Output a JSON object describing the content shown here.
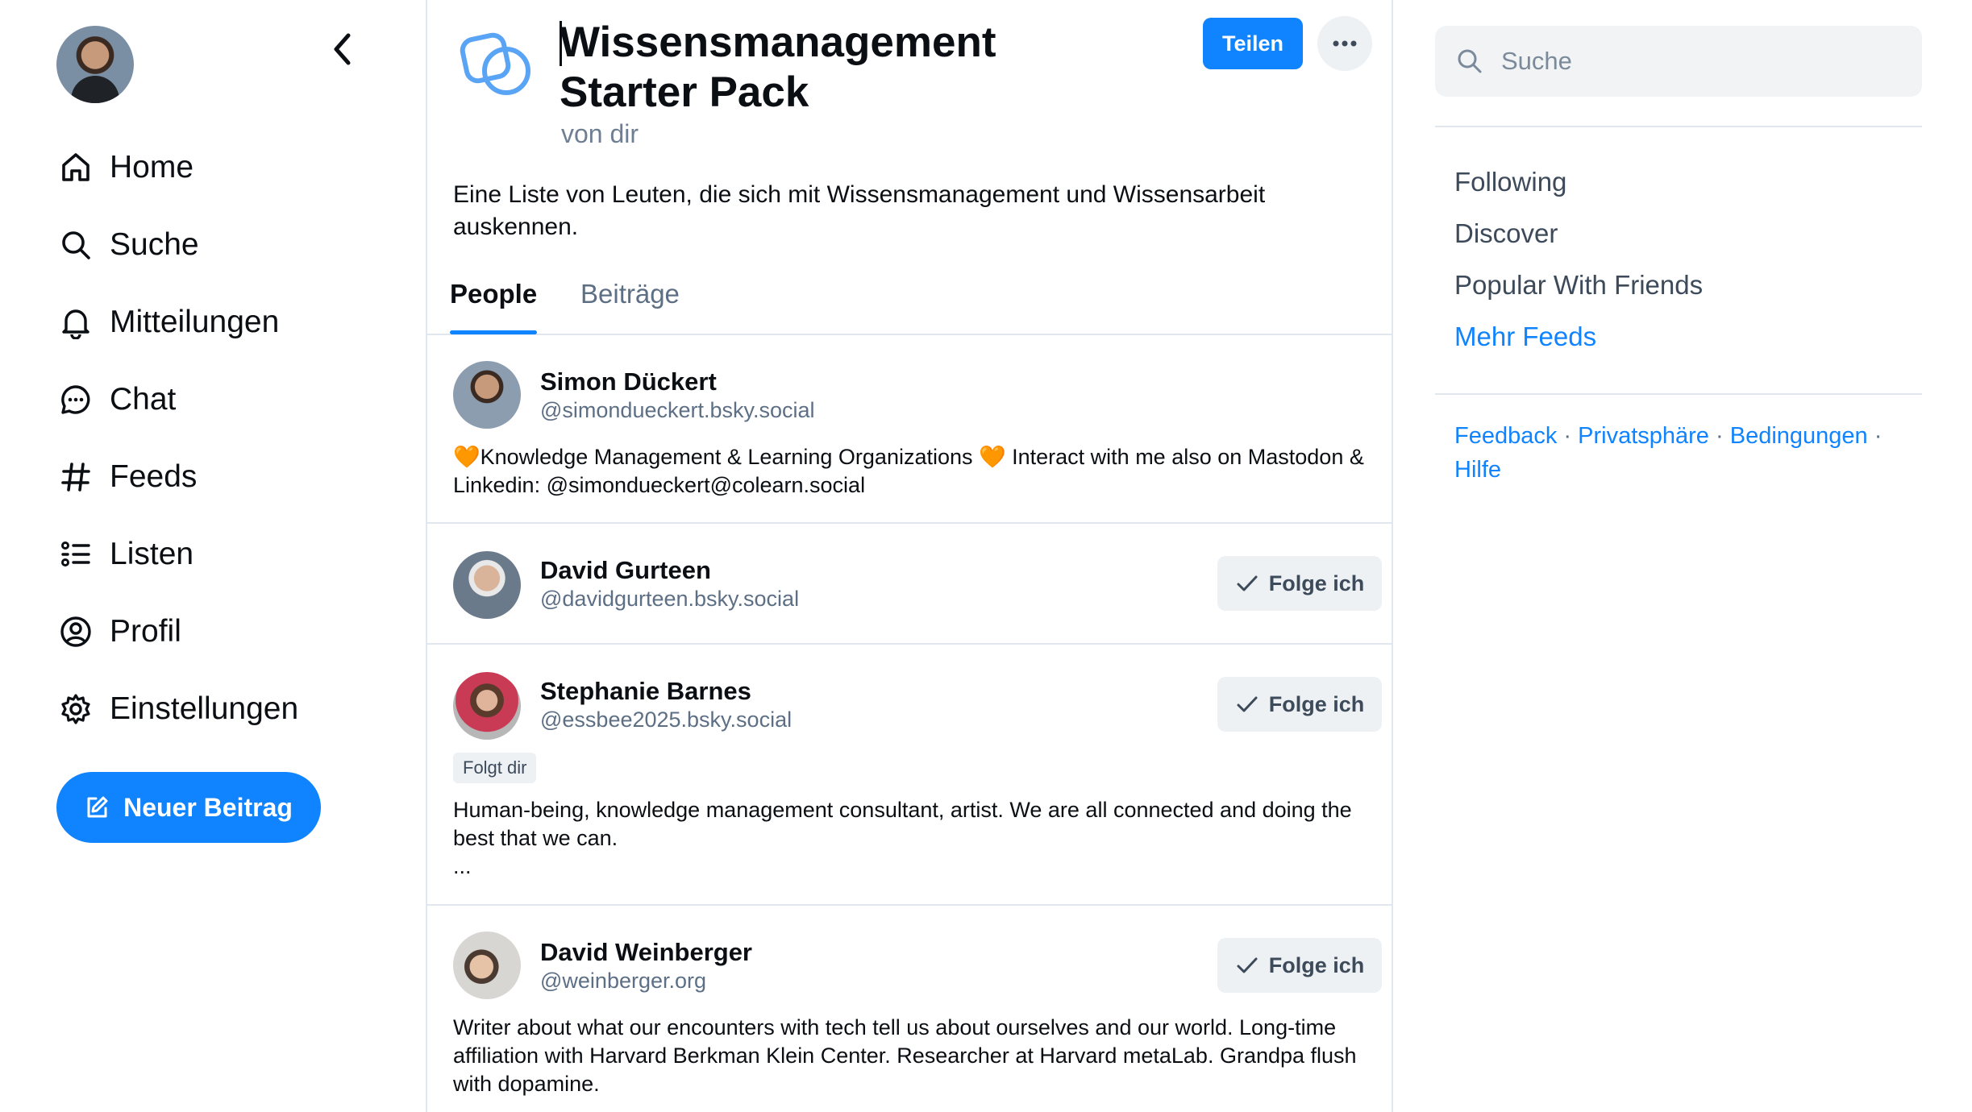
{
  "sidebar": {
    "items": [
      {
        "label": "Home",
        "icon": "home-icon"
      },
      {
        "label": "Suche",
        "icon": "search-icon"
      },
      {
        "label": "Mitteilungen",
        "icon": "bell-icon"
      },
      {
        "label": "Chat",
        "icon": "chat-bubble-icon"
      },
      {
        "label": "Feeds",
        "icon": "hash-icon"
      },
      {
        "label": "Listen",
        "icon": "list-icon"
      },
      {
        "label": "Profil",
        "icon": "user-circle-icon"
      },
      {
        "label": "Einstellungen",
        "icon": "gear-icon"
      }
    ],
    "new_post_label": "Neuer Beitrag"
  },
  "pack": {
    "title": "Wissensmanagement Starter Pack",
    "byline": "von dir",
    "share_label": "Teilen",
    "description": "Eine Liste von Leuten, die sich mit Wissensmanagement und Wissensarbeit auskennen.",
    "tabs": [
      {
        "label": "People",
        "active": true
      },
      {
        "label": "Beiträge",
        "active": false
      }
    ]
  },
  "people": [
    {
      "name": "Simon Dückert",
      "handle": "@simondueckert.bsky.social",
      "bio": "🧡Knowledge Management & Learning Organizations 🧡 Interact with me also on Mastodon & Linkedin: @simondueckert@colearn.social"
    },
    {
      "name": "David Gurteen",
      "handle": "@davidgurteen.bsky.social",
      "follow_label": "Folge ich"
    },
    {
      "name": "Stephanie Barnes",
      "handle": "@essbee2025.bsky.social",
      "follow_label": "Folge ich",
      "badge": "Folgt dir",
      "bio": "Human-being, knowledge management consultant, artist. We are all connected and doing the best that we can.\n..."
    },
    {
      "name": "David Weinberger",
      "handle": "@weinberger.org",
      "follow_label": "Folge ich",
      "bio": "Writer about what our encounters with tech tell us about ourselves and our world. Long-time affiliation with Harvard Berkman Klein Center. Researcher at Harvard metaLab. Grandpa flush with dopamine."
    }
  ],
  "right": {
    "search_placeholder": "Suche",
    "feeds": [
      "Following",
      "Discover",
      "Popular With Friends"
    ],
    "more_feeds": "Mehr Feeds",
    "footer": [
      "Feedback",
      "Privatsphäre",
      "Bedingungen",
      "Hilfe"
    ]
  },
  "colors": {
    "accent": "#1083fe",
    "muted": "#5d6f85",
    "border": "#e2e7ee"
  }
}
